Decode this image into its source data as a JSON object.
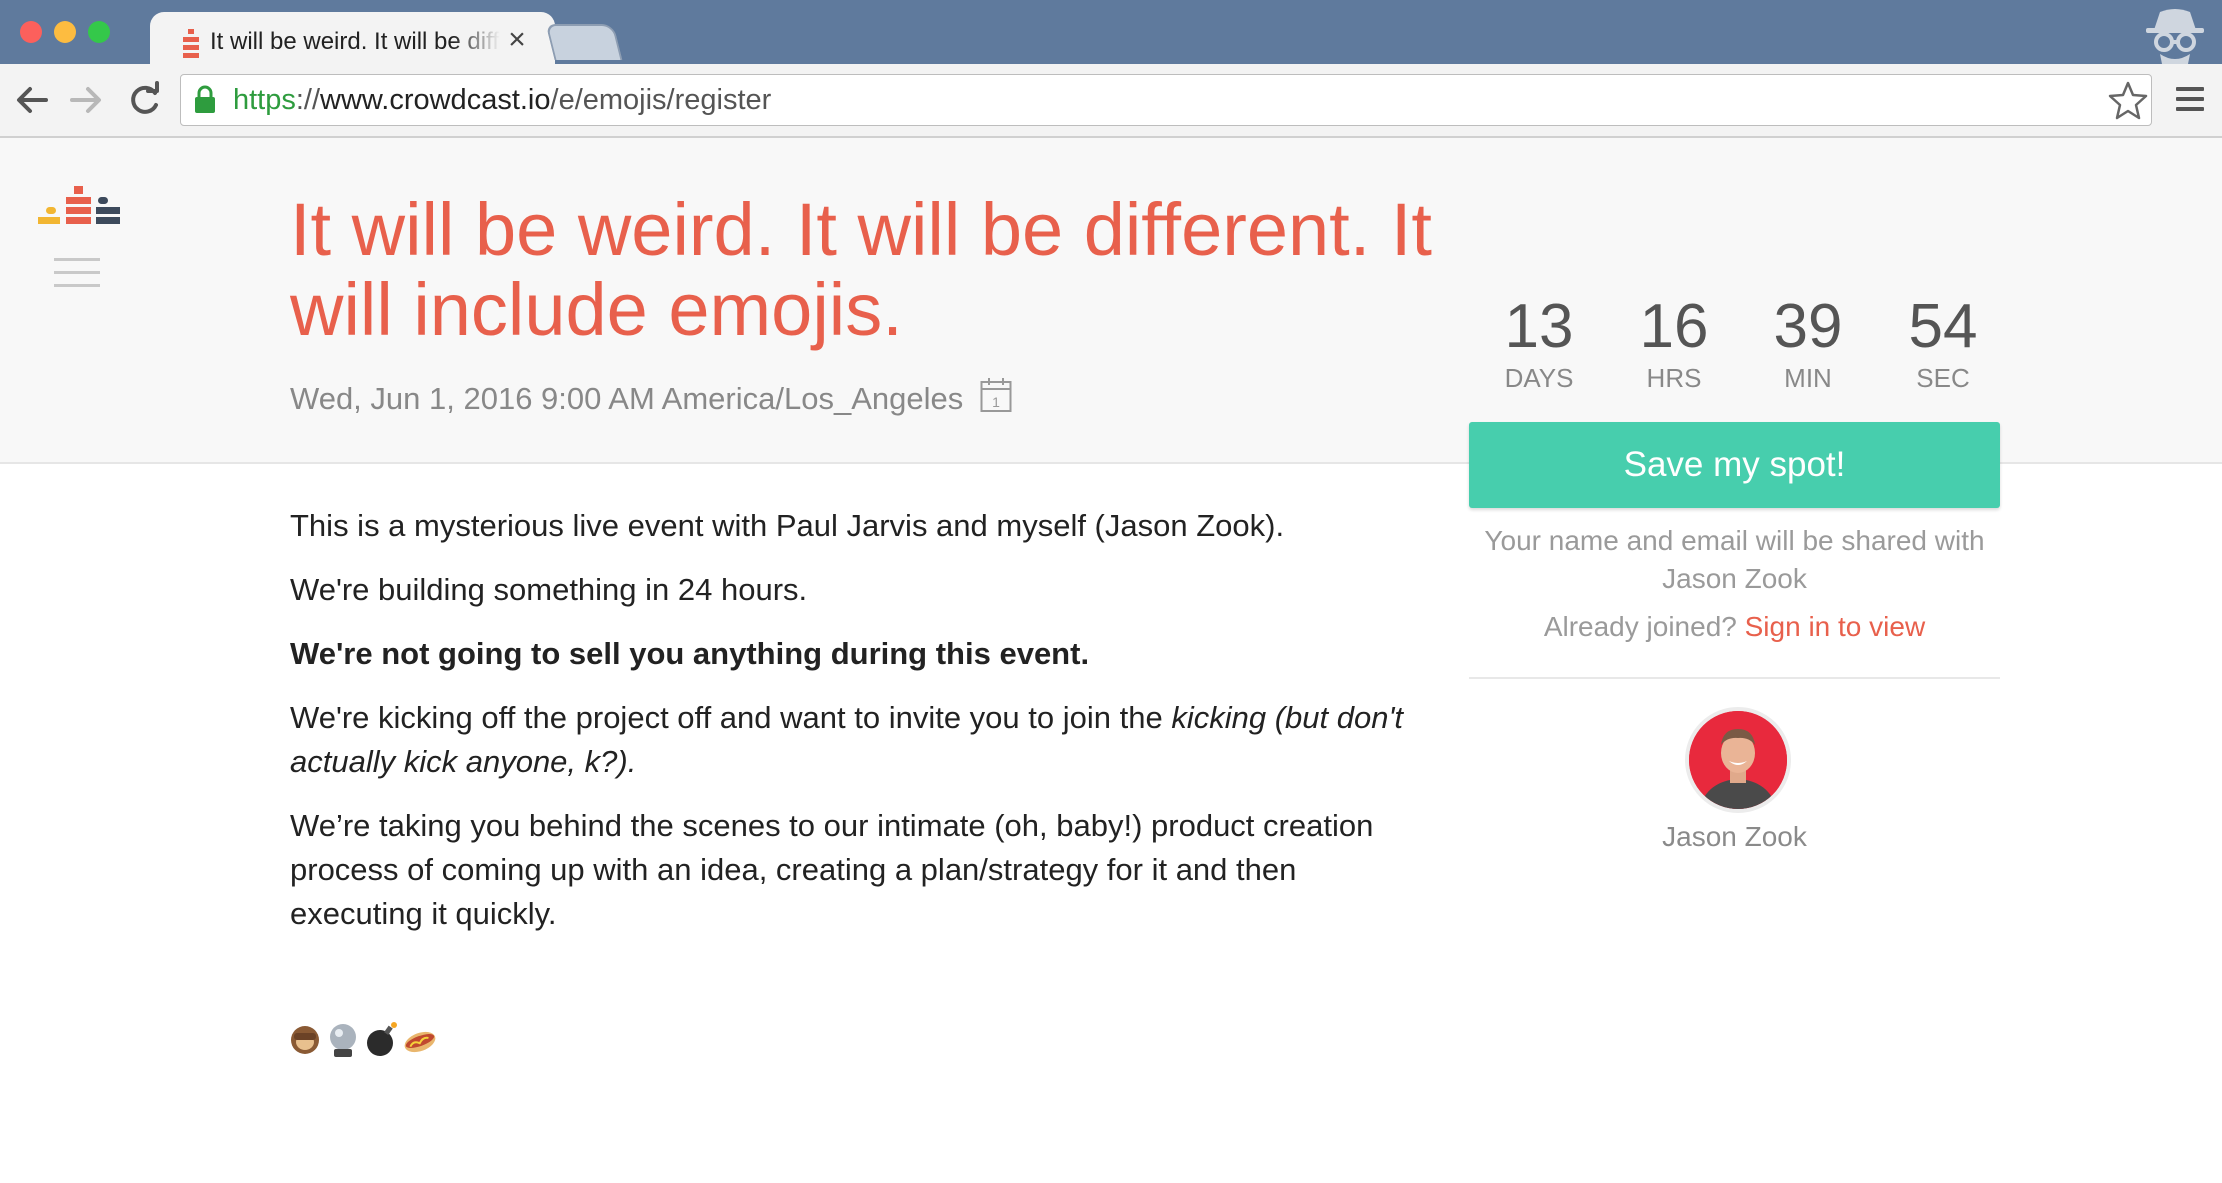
{
  "browser": {
    "tab_title": "It will be weird. It will be different. It will include emojis.",
    "tab_close": "×",
    "url": {
      "scheme": "https",
      "separator": "://",
      "domain": "www.crowdcast.io",
      "path": "/e/emojis/register"
    }
  },
  "event": {
    "title": "It will be weird. It will be different. It will include emojis.",
    "date": "Wed, Jun 1, 2016 9:00 AM America/Los_Angeles",
    "calendar_day": "1"
  },
  "countdown": {
    "days": "13",
    "days_label": "DAYS",
    "hours": "16",
    "hours_label": "HRS",
    "minutes": "39",
    "minutes_label": "MIN",
    "seconds": "54",
    "seconds_label": "SEC"
  },
  "registration": {
    "button_label": "Save my spot!",
    "share_note": "Your name and email will be shared with Jason Zook",
    "already_joined": "Already joined?",
    "sign_in_link": "Sign in to view"
  },
  "host": {
    "name": "Jason Zook"
  },
  "description": {
    "p1": "This is a mysterious live event with Paul Jarvis and myself (Jason Zook).",
    "p2": "We're building something in 24 hours.",
    "p3": "We're not going to sell you anything during this event.",
    "p4_plain": "We're kicking off the project off and want to invite you to join the ",
    "p4_italic": "kicking (but don't actually kick anyone, k?).",
    "p5": "We’re taking you behind the scenes to our intimate (oh, baby!) product creation process of coming up with an idea, creating a plan/strategy for it and then executing it quickly."
  },
  "emojis": [
    "speak-no-evil-monkey-icon",
    "crystal-ball-icon",
    "bomb-icon",
    "hot-dog-icon"
  ],
  "colors": {
    "accent": "#e8604c",
    "button": "#47cead",
    "chrome": "#5f7a9d"
  }
}
